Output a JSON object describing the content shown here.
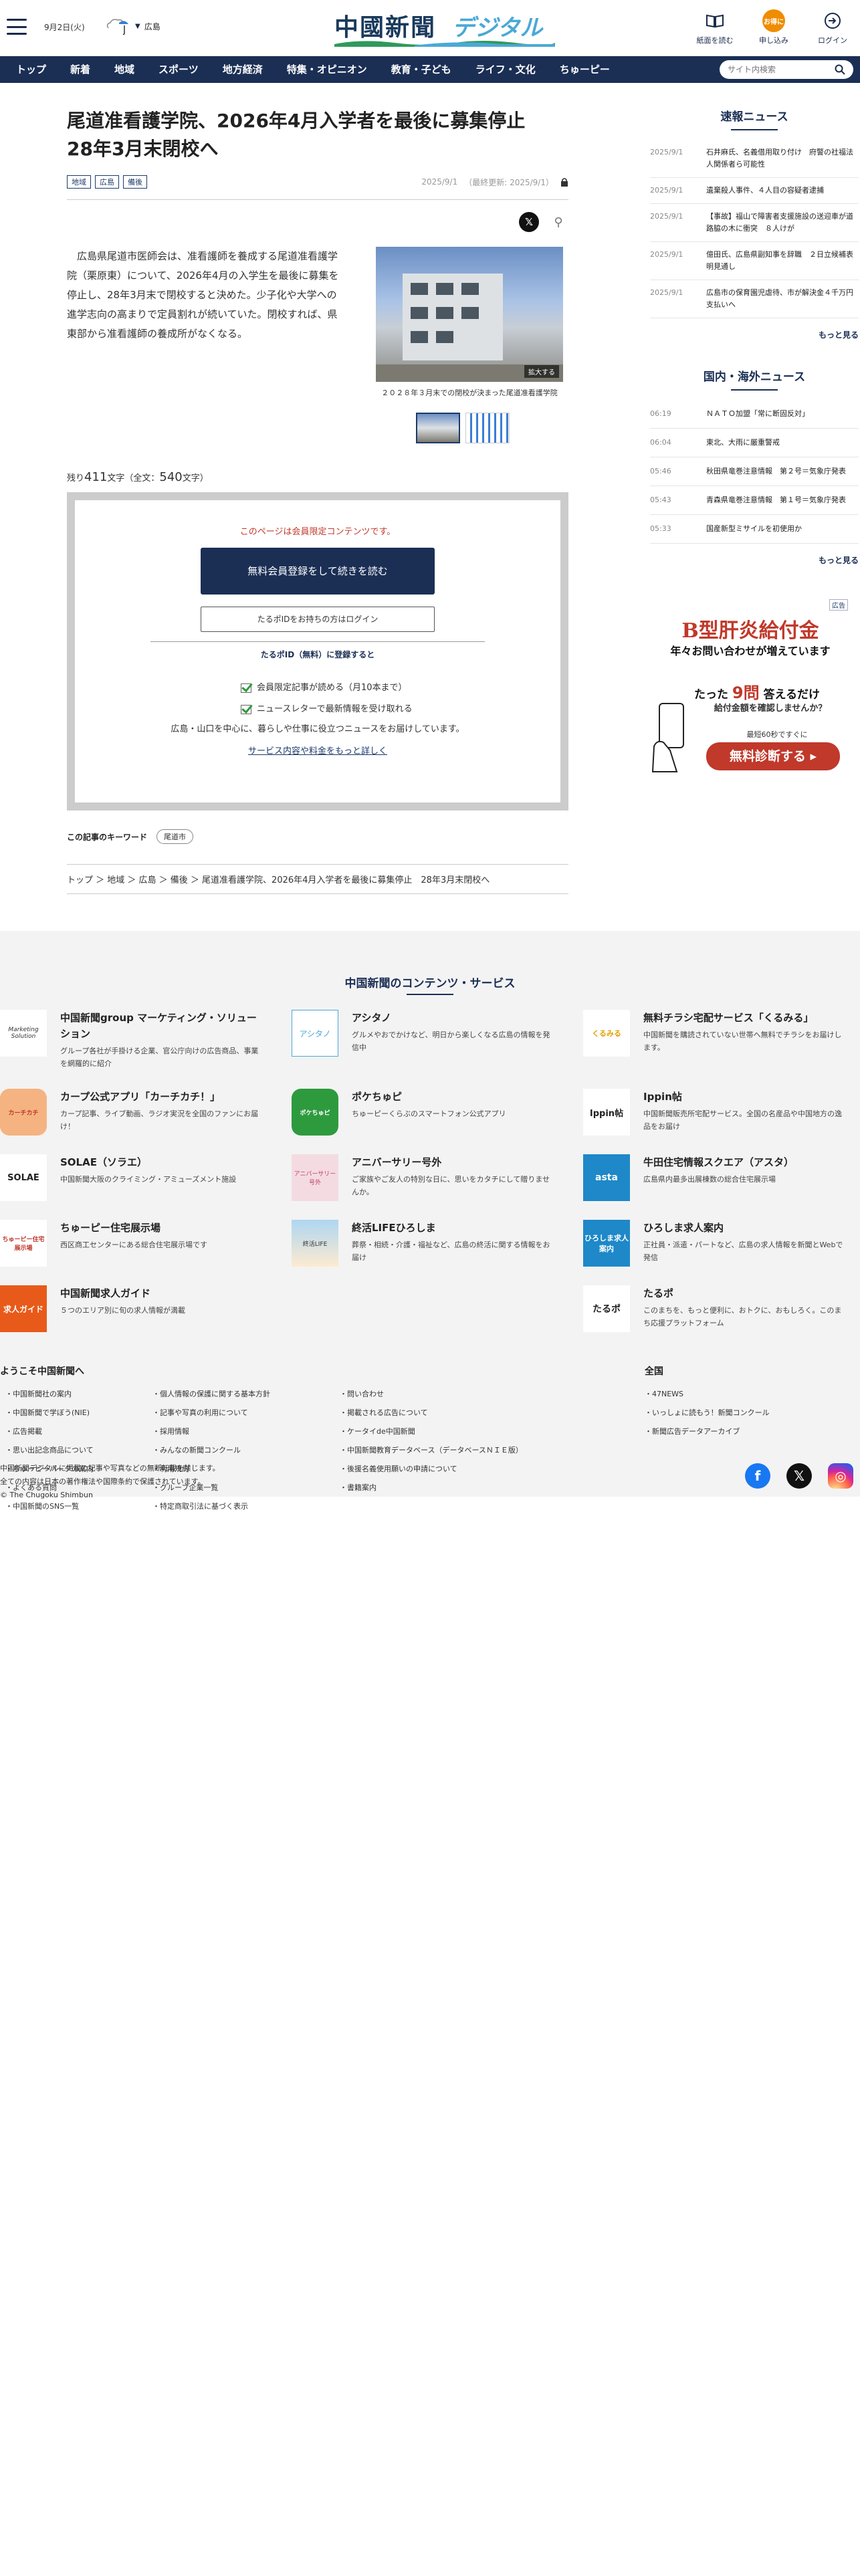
{
  "header": {
    "date": "9月2日(火)",
    "weather_area": "広島",
    "logo_main": "中國新聞",
    "logo_sub": "デジタル",
    "buttons": [
      {
        "label": "紙面を読む",
        "icon": "newspaper-icon"
      },
      {
        "label": "申し込み",
        "icon": "apply-icon",
        "badge": "お得に"
      },
      {
        "label": "ログイン",
        "icon": "login-icon"
      }
    ]
  },
  "nav": {
    "items": [
      "トップ",
      "新着",
      "地域",
      "スポーツ",
      "地方経済",
      "特集・オピニオン",
      "教育・子ども",
      "ライフ・文化",
      "ちゅーピー"
    ],
    "search_placeholder": "サイト内検索"
  },
  "article": {
    "title": "尾道准看護学院、2026年4月入学者を最後に募集停止　28年3月末閉校へ",
    "tags": [
      "地域",
      "広島",
      "備後"
    ],
    "published": "2025/9/1",
    "updated": "（最終更新: 2025/9/1）",
    "body": "広島県尾道市医師会は、准看護師を養成する尾道准看護学院（栗原東）について、2026年4月の入学生を最後に募集を停止し、28年3月末で閉校すると決めた。少子化や大学への進学志向の高まりで定員割れが続いていた。閉校すれば、県東部から准看護師の養成所がなくなる。",
    "photo_zoom": "拡大する",
    "photo_caption": "２０２８年３月末での閉校が決まった尾道准看護学院",
    "remaining_prefix": "残り",
    "remaining_count": "411",
    "remaining_mid": "文字（全文：",
    "total_count": "540",
    "remaining_suffix": "文字）",
    "paywall": {
      "notice": "このページは会員限定コンテンツです。",
      "register_button": "無料会員登録をして続きを読む",
      "login_button": "たるポIDをお持ちの方はログイン",
      "register_heading": "たるポID（無料）に登録すると",
      "benefits": [
        "会員限定記事が読める（月10本まで）",
        "ニュースレターで最新情報を受け取れる"
      ],
      "description": "広島・山口を中心に、暮らしや仕事に役立つニュースをお届けしています。",
      "more_link": "サービス内容や料金をもっと詳しく"
    },
    "keyword_label": "この記事のキーワード",
    "keywords": [
      "尾道市"
    ],
    "breadcrumbs": "トップ ＞ 地域 ＞ 広島 ＞ 備後 ＞ 尾道准看護学院、2026年4月入学者を最後に募集停止　28年3月末閉校へ"
  },
  "sidebar": {
    "breaking_title": "速報ニュース",
    "breaking": [
      {
        "date": "2025/9/1",
        "title": "石井麻氏、名義借用取り付け　府警の社福法人関係者ら可能性"
      },
      {
        "date": "2025/9/1",
        "title": "遺棄殺人事件、４人目の容疑者逮捕"
      },
      {
        "date": "2025/9/1",
        "title": "【事故】福山で障害者支援施設の送迎車が道路脇の木に衝突　８人けが"
      },
      {
        "date": "2025/9/1",
        "title": "億田氏、広島県副知事を辞職　２日立候補表明見通し"
      },
      {
        "date": "2025/9/1",
        "title": "広島市の保育園児虐待、市が解決金４千万円支払いへ"
      }
    ],
    "more_label": "もっと見る",
    "world_title": "国内・海外ニュース",
    "world": [
      {
        "date": "06:19",
        "title": "ＮＡＴＯ加盟「常に断固反対」"
      },
      {
        "date": "06:04",
        "title": "東北、大雨に厳重警戒"
      },
      {
        "date": "05:46",
        "title": "秋田県竜巻注意情報　第２号＝気象庁発表"
      },
      {
        "date": "05:43",
        "title": "青森県竜巻注意情報　第１号＝気象庁発表"
      },
      {
        "date": "05:33",
        "title": "国産新型ミサイルを初使用か"
      }
    ],
    "ad": {
      "label": "広告",
      "headline": "B型肝炎給付金",
      "sub": "年々お問い合わせが増えています",
      "q_prefix": "たった",
      "q_num": "9問",
      "q_suffix": "答えるだけ",
      "q2": "給付金額を確認しませんか？",
      "time": "最短60秒ですぐに",
      "cta": "無料診断する ▸"
    }
  },
  "services": {
    "title": "中国新聞のコンテンツ・サービス",
    "items": [
      {
        "name": "中国新聞group マーケティング・ソリューション",
        "desc": "グループ各社が手掛ける企業、官公庁向けの広告商品、事業を網羅的に紹介",
        "logo": "Marketing Solution"
      },
      {
        "name": "アシタノ",
        "desc": "グルメやおでかけなど、明日から楽しくなる広島の情報を発信中",
        "logo": "アシタノ"
      },
      {
        "name": "無料チラシ宅配サービス「くるみる」",
        "desc": "中国新聞を購読されていない世帯へ無料でチラシをお届けします。",
        "logo": "くるみる"
      },
      {
        "name": "カープ公式アプリ「カーチカチ！」",
        "desc": "カープ記事、ライブ動画、ラジオ実況を全国のファンにお届け！",
        "logo": "カーチカチ"
      },
      {
        "name": "ポケちゅピ",
        "desc": "ちゅーピーくらぶのスマートフォン公式アプリ",
        "logo": "ポケちゅピ"
      },
      {
        "name": "Ippin帖",
        "desc": "中国新聞販売所宅配サービス。全国の名産品や中国地方の逸品をお届け",
        "logo": "Ippin帖"
      },
      {
        "name": "SOLAE（ソラエ）",
        "desc": "中国新聞大阪のクライミング・アミューズメント施設",
        "logo": "SOLAE"
      },
      {
        "name": "アニバーサリー号外",
        "desc": "ご家族やご友人の特別な日に、思いをカタチにして贈りませんか。",
        "logo": "アニバーサリー号外"
      },
      {
        "name": "牛田住宅情報スクエア（アスタ）",
        "desc": "広島県内最多出展棟数の総合住宅展示場",
        "logo": "asta"
      },
      {
        "name": "ちゅーピー住宅展示場",
        "desc": "西区商工センターにある総合住宅展示場です",
        "logo": "ちゅーピー住宅展示場"
      },
      {
        "name": "終活LIFEひろしま",
        "desc": "葬祭・相続・介護・福祉など、広島の終活に関する情報をお届け",
        "logo": "終活LIFE"
      },
      {
        "name": "ひろしま求人案内",
        "desc": "正社員・派遣・パートなど、広島の求人情報を新聞とWebで発信",
        "logo": "ひろしま求人案内"
      },
      {
        "name": "中国新聞求人ガイド",
        "desc": "５つのエリア別に旬の求人情報が満載",
        "logo": "求人ガイド"
      },
      {
        "name": "たるポ",
        "desc": "このまちを、もっと便利に、おトクに、おもしろく。このまち応援プラットフォーム",
        "logo": "たるポ"
      }
    ]
  },
  "footer": {
    "welcome_title": "ようこそ中国新聞へ",
    "col1": [
      "中国新聞社の案内",
      "中国新聞で学ぼう(NIE)",
      "広告掲載",
      "思い出記念商品について",
      "ちゅーピーパークの案内",
      "よくある質問",
      "中国新聞のSNS一覧"
    ],
    "col2": [
      "個人情報の保護に関する基本方針",
      "記事や写真の利用について",
      "採用情報",
      "みんなの新聞コンクール",
      "利用規約",
      "グループ企業一覧",
      "特定商取引法に基づく表示"
    ],
    "col3": [
      "問い合わせ",
      "掲載される広告について",
      "ケータイde中国新聞",
      "中国新聞教育データベース（データベースＮＩＥ版）",
      "後援名義使用願いの申請について",
      "書籍案内"
    ],
    "national_title": "全国",
    "col4": [
      "47NEWS",
      "いっしょに読もう！新聞コンクール",
      "新聞広告データアーカイブ"
    ],
    "copyright": [
      "中国新聞デジタルに掲載の記事や写真などの無断転載を禁じます。",
      "全ての内容は日本の著作権法や国際条約で保護されています。",
      "© The Chugoku Shimbun"
    ],
    "social": [
      "facebook-icon",
      "x-icon",
      "instagram-icon"
    ]
  }
}
